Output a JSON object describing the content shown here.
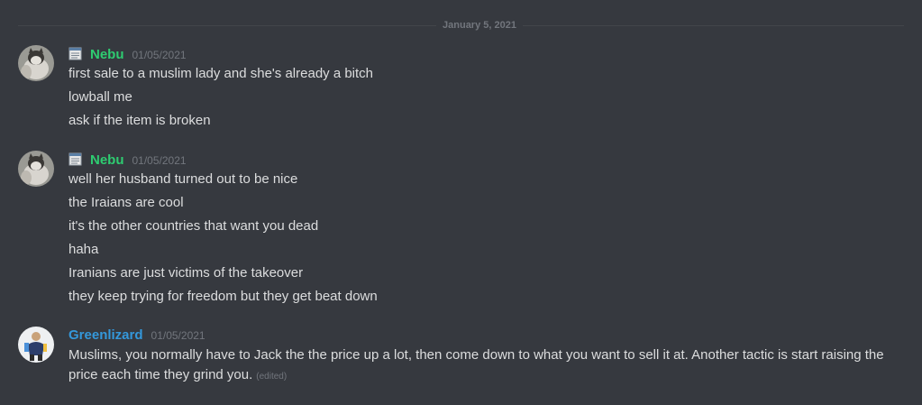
{
  "divider": {
    "date": "January 5, 2021"
  },
  "messages": [
    {
      "username": "Nebu",
      "timestamp": "01/05/2021",
      "username_color": "#2ecc71",
      "badge_icon": "notepad-icon",
      "avatar_icon": "cat-avatar",
      "lines": [
        "first sale to a muslim lady and she's already a bitch",
        "lowball me",
        "ask if the item is broken"
      ]
    },
    {
      "username": "Nebu",
      "timestamp": "01/05/2021",
      "username_color": "#2ecc71",
      "badge_icon": "notepad-icon",
      "avatar_icon": "cat-avatar",
      "lines": [
        "well her husband turned out to be nice",
        "the Iraians are cool",
        "it's the other countries that want you dead",
        "haha",
        "Iranians are just victims of the takeover",
        "they keep trying for freedom but they get beat down"
      ]
    },
    {
      "username": "Greenlizard",
      "timestamp": "01/05/2021",
      "username_color": "#3498db",
      "avatar_icon": "person-avatar",
      "lines": [
        "Muslims, you normally have to Jack the the price up a lot, then come down to what you want to sell it at.  Another tactic is start raising the price each time they grind you."
      ],
      "edited_label": "(edited)"
    }
  ]
}
